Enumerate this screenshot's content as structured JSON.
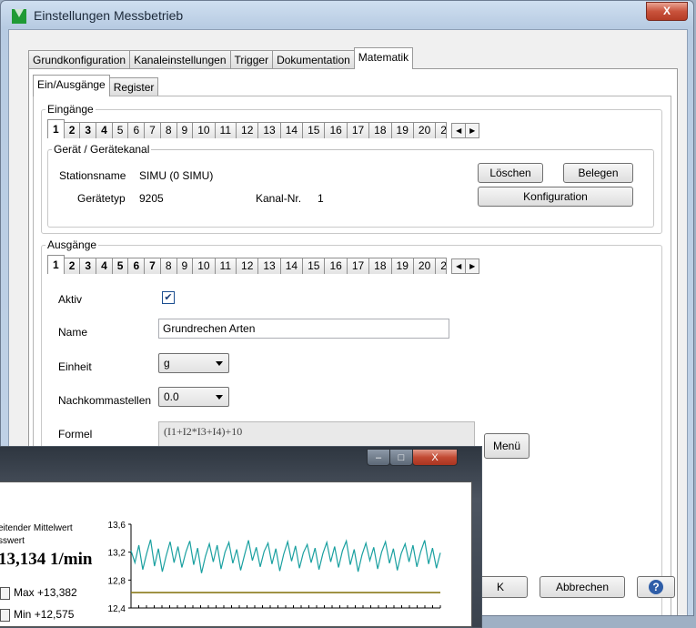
{
  "window": {
    "title": "Einstellungen Messbetrieb",
    "close": "X"
  },
  "main_tabs": [
    "Grundkonfiguration",
    "Kanaleinstellungen",
    "Trigger",
    "Dokumentation",
    "Matematik"
  ],
  "sub_tabs": [
    "Ein/Ausgänge",
    "Register"
  ],
  "inputs_group": {
    "legend": "Eingänge",
    "channels": [
      "1",
      "2",
      "3",
      "4",
      "5",
      "6",
      "7",
      "8",
      "9",
      "10",
      "11",
      "12",
      "13",
      "14",
      "15",
      "16",
      "17",
      "18",
      "19",
      "20",
      "2"
    ],
    "device": {
      "legend": "Gerät / Gerätekanal",
      "station_label": "Stationsname",
      "station_value": "SIMU (0 SIMU)",
      "type_label": "Gerätetyp",
      "type_value": "9205",
      "channel_label": "Kanal-Nr.",
      "channel_value": "1",
      "delete": "Löschen",
      "assign": "Belegen",
      "config": "Konfiguration"
    }
  },
  "outputs_group": {
    "legend": "Ausgänge",
    "channels": [
      "1",
      "2",
      "3",
      "4",
      "5",
      "6",
      "7",
      "8",
      "9",
      "10",
      "11",
      "12",
      "13",
      "14",
      "15",
      "16",
      "17",
      "18",
      "19",
      "20",
      "2"
    ],
    "active_label": "Aktiv",
    "active_checked": true,
    "name_label": "Name",
    "name_value": "Grundrechen Arten",
    "unit_label": "Einheit",
    "unit_value": "g",
    "decimals_label": "Nachkommastellen",
    "decimals_value": "0.0",
    "formula_label": "Formel",
    "formula_value": "(I1+I2*I3+I4)+10",
    "menu": "Menü"
  },
  "footer": {
    "ok": "K",
    "cancel": "Abbrechen",
    "help": "?"
  },
  "overlay": {
    "label1": "eitender Mittelwert",
    "label2": "sswert",
    "value": "13,134 1/min",
    "max_label": "Max",
    "max_value": "+13,382",
    "min_label": "Min",
    "min_value": "+12,575",
    "btn_min": "–",
    "btn_max": "□",
    "btn_close": "X",
    "chart_data": {
      "type": "line",
      "y_ticks": [
        "13,6",
        "13,2",
        "12,8",
        "12,4"
      ],
      "ylim": [
        12.4,
        13.6
      ],
      "series": [
        {
          "color": "#1aa0a0",
          "values": [
            13.22,
            13.05,
            13.3,
            12.95,
            13.18,
            13.38,
            13.0,
            13.25,
            12.92,
            13.15,
            13.35,
            13.05,
            13.28,
            12.98,
            13.2,
            13.36,
            13.02,
            13.26,
            12.9,
            13.14,
            13.32,
            13.06,
            13.3,
            12.96,
            13.2,
            13.34,
            13.04,
            13.24,
            12.94,
            13.16,
            13.37,
            13.08,
            13.27,
            12.99,
            13.21,
            13.33,
            13.03,
            13.25,
            12.93,
            13.17,
            13.35,
            13.07,
            13.29,
            12.97,
            13.19,
            13.31,
            13.05,
            13.26,
            12.95,
            13.18,
            13.34,
            13.06,
            13.28,
            12.98,
            13.22,
            13.36,
            13.02,
            13.24,
            12.92,
            13.16,
            13.33,
            13.08,
            13.27,
            12.96,
            13.2,
            13.35,
            13.04,
            13.25,
            12.94,
            13.18,
            13.32,
            13.06,
            13.3,
            12.99,
            13.21,
            13.37,
            13.03,
            13.26,
            12.97,
            13.19
          ]
        },
        {
          "color": "#8a7a1a",
          "values": [
            12.62,
            12.62
          ]
        }
      ]
    }
  }
}
